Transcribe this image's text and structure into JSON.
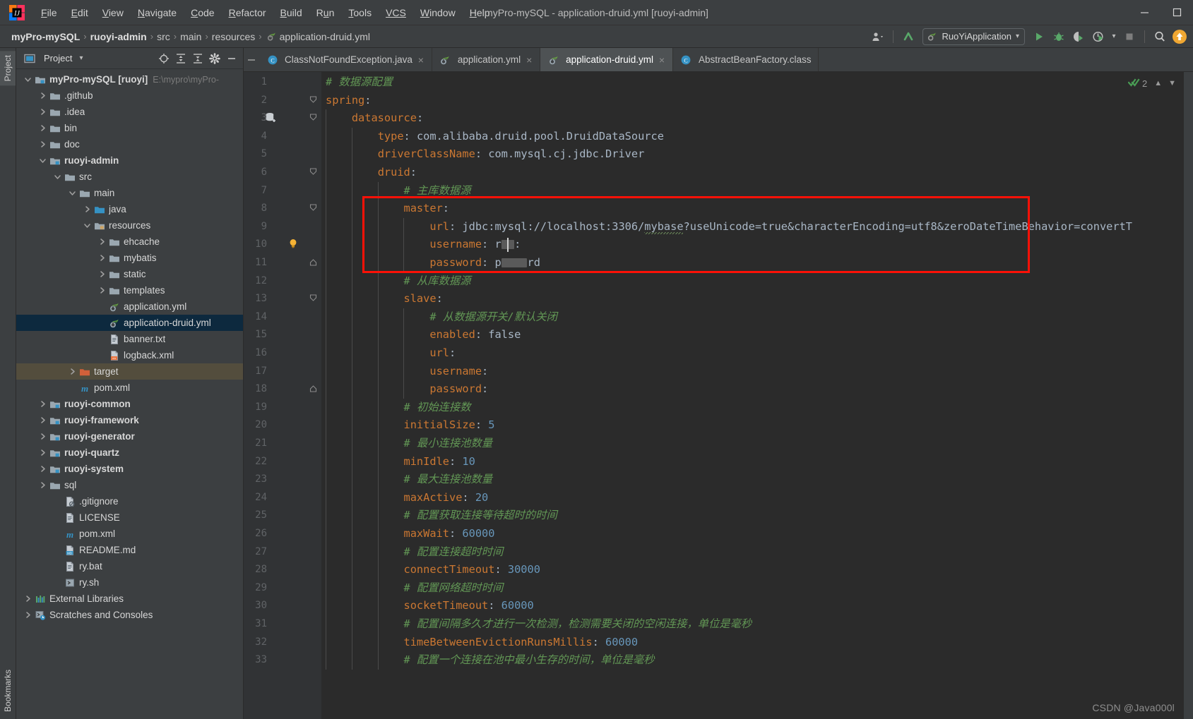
{
  "window": {
    "title": "myPro-mySQL - application-druid.yml [ruoyi-admin]",
    "minimize": "—",
    "maximize": "❐",
    "app_icon": "intellij-idea-logo"
  },
  "menubar": [
    {
      "label": "File",
      "mnemonic": "F"
    },
    {
      "label": "Edit",
      "mnemonic": "E"
    },
    {
      "label": "View",
      "mnemonic": "V"
    },
    {
      "label": "Navigate",
      "mnemonic": "N"
    },
    {
      "label": "Code",
      "mnemonic": "C"
    },
    {
      "label": "Refactor",
      "mnemonic": "R"
    },
    {
      "label": "Build",
      "mnemonic": "B"
    },
    {
      "label": "Run",
      "mnemonic": "u"
    },
    {
      "label": "Tools",
      "mnemonic": "T"
    },
    {
      "label": "VCS",
      "mnemonic": "V"
    },
    {
      "label": "Window",
      "mnemonic": "W"
    },
    {
      "label": "Help",
      "mnemonic": "H"
    }
  ],
  "breadcrumb": {
    "separator": "›",
    "items": [
      {
        "label": "myPro-mySQL",
        "bold": true,
        "icon": ""
      },
      {
        "label": "ruoyi-admin",
        "bold": true,
        "icon": ""
      },
      {
        "label": "src",
        "bold": false,
        "icon": ""
      },
      {
        "label": "main",
        "bold": false,
        "icon": ""
      },
      {
        "label": "resources",
        "bold": false,
        "icon": ""
      },
      {
        "label": "application-druid.yml",
        "bold": false,
        "icon": "spring-yaml-icon"
      }
    ]
  },
  "toolbar": {
    "run_configuration": "RuoYiApplication",
    "dropdown_caret": "▾",
    "buttons": [
      {
        "name": "user-settings-icon",
        "label": ""
      },
      {
        "name": "update-project-icon",
        "label": ""
      },
      {
        "name": "run-icon",
        "label": ""
      },
      {
        "name": "debug-icon",
        "label": ""
      },
      {
        "name": "run-with-coverage-icon",
        "label": ""
      },
      {
        "name": "profile-icon",
        "label": ""
      },
      {
        "name": "stop-icon",
        "label": ""
      },
      {
        "name": "search-everywhere-icon",
        "label": ""
      },
      {
        "name": "notifications-icon",
        "label": ""
      }
    ]
  },
  "left_strip": {
    "top_tab": "Project",
    "bottom_tab": "Bookmarks"
  },
  "project_panel": {
    "title": "Project",
    "title_caret": "▾",
    "header_icons": [
      "locate-icon",
      "expand-all-icon",
      "collapse-all-icon",
      "settings-gear-icon",
      "hide-icon"
    ],
    "tree": [
      {
        "depth": 0,
        "label": "myPro-mySQL [ruoyi]",
        "hint": "E:\\mypro\\myPro-",
        "icon": "module-folder-icon",
        "arrow": "expanded",
        "bold": true
      },
      {
        "depth": 1,
        "label": ".github",
        "icon": "folder-icon",
        "arrow": "collapsed"
      },
      {
        "depth": 1,
        "label": ".idea",
        "icon": "folder-icon",
        "arrow": "collapsed"
      },
      {
        "depth": 1,
        "label": "bin",
        "icon": "folder-icon",
        "arrow": "collapsed"
      },
      {
        "depth": 1,
        "label": "doc",
        "icon": "folder-icon",
        "arrow": "collapsed"
      },
      {
        "depth": 1,
        "label": "ruoyi-admin",
        "icon": "module-folder-icon",
        "arrow": "expanded",
        "bold": true
      },
      {
        "depth": 2,
        "label": "src",
        "icon": "folder-icon",
        "arrow": "expanded"
      },
      {
        "depth": 3,
        "label": "main",
        "icon": "folder-icon",
        "arrow": "expanded"
      },
      {
        "depth": 4,
        "label": "java",
        "icon": "source-folder-icon",
        "arrow": "collapsed"
      },
      {
        "depth": 4,
        "label": "resources",
        "icon": "resource-folder-icon",
        "arrow": "expanded"
      },
      {
        "depth": 5,
        "label": "ehcache",
        "icon": "folder-icon",
        "arrow": "collapsed"
      },
      {
        "depth": 5,
        "label": "mybatis",
        "icon": "folder-icon",
        "arrow": "collapsed"
      },
      {
        "depth": 5,
        "label": "static",
        "icon": "folder-icon",
        "arrow": "collapsed"
      },
      {
        "depth": 5,
        "label": "templates",
        "icon": "folder-icon",
        "arrow": "collapsed"
      },
      {
        "depth": 5,
        "label": "application.yml",
        "icon": "spring-yaml-icon",
        "arrow": "none"
      },
      {
        "depth": 5,
        "label": "application-druid.yml",
        "icon": "spring-yaml-icon",
        "arrow": "none",
        "selected": true
      },
      {
        "depth": 5,
        "label": "banner.txt",
        "icon": "text-file-icon",
        "arrow": "none"
      },
      {
        "depth": 5,
        "label": "logback.xml",
        "icon": "xml-file-icon",
        "arrow": "none"
      },
      {
        "depth": 3,
        "label": "target",
        "icon": "target-folder-icon",
        "arrow": "collapsed",
        "highlight": true
      },
      {
        "depth": 3,
        "label": "pom.xml",
        "icon": "maven-icon",
        "arrow": "none"
      },
      {
        "depth": 1,
        "label": "ruoyi-common",
        "icon": "module-folder-icon",
        "arrow": "collapsed",
        "bold": true
      },
      {
        "depth": 1,
        "label": "ruoyi-framework",
        "icon": "module-folder-icon",
        "arrow": "collapsed",
        "bold": true
      },
      {
        "depth": 1,
        "label": "ruoyi-generator",
        "icon": "module-folder-icon",
        "arrow": "collapsed",
        "bold": true
      },
      {
        "depth": 1,
        "label": "ruoyi-quartz",
        "icon": "module-folder-icon",
        "arrow": "collapsed",
        "bold": true
      },
      {
        "depth": 1,
        "label": "ruoyi-system",
        "icon": "module-folder-icon",
        "arrow": "collapsed",
        "bold": true
      },
      {
        "depth": 1,
        "label": "sql",
        "icon": "folder-icon",
        "arrow": "collapsed"
      },
      {
        "depth": 2,
        "label": ".gitignore",
        "icon": "gitignore-icon",
        "arrow": "none"
      },
      {
        "depth": 2,
        "label": "LICENSE",
        "icon": "text-file-icon",
        "arrow": "none"
      },
      {
        "depth": 2,
        "label": "pom.xml",
        "icon": "maven-icon",
        "arrow": "none"
      },
      {
        "depth": 2,
        "label": "README.md",
        "icon": "markdown-icon",
        "arrow": "none"
      },
      {
        "depth": 2,
        "label": "ry.bat",
        "icon": "text-file-icon",
        "arrow": "none"
      },
      {
        "depth": 2,
        "label": "ry.sh",
        "icon": "shell-script-icon",
        "arrow": "none"
      },
      {
        "depth": 0,
        "label": "External Libraries",
        "icon": "libraries-icon",
        "arrow": "collapsed"
      },
      {
        "depth": 0,
        "label": "Scratches and Consoles",
        "icon": "scratches-icon",
        "arrow": "collapsed"
      }
    ]
  },
  "editor_tabs": [
    {
      "label": "ClassNotFoundException.java",
      "icon": "java-class-icon",
      "active": false,
      "close": "×"
    },
    {
      "label": "application.yml",
      "icon": "spring-yaml-icon",
      "active": false,
      "close": "×"
    },
    {
      "label": "application-druid.yml",
      "icon": "spring-yaml-icon",
      "active": true,
      "close": "×"
    },
    {
      "label": "AbstractBeanFactory.class",
      "icon": "java-class-icon",
      "active": false,
      "close": "×"
    }
  ],
  "inspection": {
    "icon": "inspection-ok-icon",
    "count": "2",
    "up_caret": "⌃",
    "down_caret": "⌄"
  },
  "watermark": "CSDN @Java000l",
  "code": {
    "language": "yaml",
    "file": "application-druid.yml",
    "line_count": 33,
    "lines": [
      {
        "n": 1,
        "indent": 0,
        "tokens": [
          {
            "t": "comment",
            "v": "# 数据源配置"
          }
        ]
      },
      {
        "n": 2,
        "indent": 0,
        "tokens": [
          {
            "t": "key",
            "v": "spring"
          },
          {
            "t": "plain",
            "v": ":"
          }
        ],
        "fold": "start"
      },
      {
        "n": 3,
        "indent": 1,
        "tokens": [
          {
            "t": "key",
            "v": "datasource"
          },
          {
            "t": "plain",
            "v": ":"
          }
        ],
        "fold": "start",
        "gutter_icon": "datasource-icon"
      },
      {
        "n": 4,
        "indent": 2,
        "tokens": [
          {
            "t": "key",
            "v": "type"
          },
          {
            "t": "plain",
            "v": ": "
          },
          {
            "t": "str",
            "v": "com.alibaba.druid.pool.DruidDataSource"
          }
        ]
      },
      {
        "n": 5,
        "indent": 2,
        "tokens": [
          {
            "t": "key",
            "v": "driverClassName"
          },
          {
            "t": "plain",
            "v": ": "
          },
          {
            "t": "str",
            "v": "com.mysql.cj.jdbc.Driver"
          }
        ]
      },
      {
        "n": 6,
        "indent": 2,
        "tokens": [
          {
            "t": "key",
            "v": "druid"
          },
          {
            "t": "plain",
            "v": ":"
          }
        ],
        "fold": "start"
      },
      {
        "n": 7,
        "indent": 3,
        "tokens": [
          {
            "t": "comment",
            "v": "# 主库数据源"
          }
        ]
      },
      {
        "n": 8,
        "indent": 3,
        "tokens": [
          {
            "t": "key",
            "v": "master"
          },
          {
            "t": "plain",
            "v": ":"
          }
        ],
        "fold": "start"
      },
      {
        "n": 9,
        "indent": 4,
        "tokens": [
          {
            "t": "key",
            "v": "url"
          },
          {
            "t": "plain",
            "v": ": "
          },
          {
            "t": "str",
            "v": "jdbc:mysql://localhost:3306/mybase?useUnicode=true&characterEncoding=utf8&zeroDateTimeBehavior=convertT"
          }
        ]
      },
      {
        "n": 10,
        "indent": 4,
        "tokens": [
          {
            "t": "key",
            "v": "username"
          },
          {
            "t": "plain",
            "v": ": "
          },
          {
            "t": "str",
            "v": "r"
          },
          {
            "t": "censor",
            "v": "xx"
          },
          {
            "t": "str",
            "v": ":"
          }
        ],
        "gutter_icon": "intention-bulb-icon"
      },
      {
        "n": 11,
        "indent": 4,
        "tokens": [
          {
            "t": "key",
            "v": "password"
          },
          {
            "t": "plain",
            "v": ": "
          },
          {
            "t": "str",
            "v": "p"
          },
          {
            "t": "censor",
            "v": "xxxx"
          },
          {
            "t": "str",
            "v": "rd"
          }
        ],
        "fold": "end"
      },
      {
        "n": 12,
        "indent": 3,
        "tokens": [
          {
            "t": "comment",
            "v": "# 从库数据源"
          }
        ]
      },
      {
        "n": 13,
        "indent": 3,
        "tokens": [
          {
            "t": "key",
            "v": "slave"
          },
          {
            "t": "plain",
            "v": ":"
          }
        ],
        "fold": "start"
      },
      {
        "n": 14,
        "indent": 4,
        "tokens": [
          {
            "t": "comment",
            "v": "# 从数据源开关/默认关闭"
          }
        ]
      },
      {
        "n": 15,
        "indent": 4,
        "tokens": [
          {
            "t": "key",
            "v": "enabled"
          },
          {
            "t": "plain",
            "v": ": "
          },
          {
            "t": "str",
            "v": "false"
          }
        ]
      },
      {
        "n": 16,
        "indent": 4,
        "tokens": [
          {
            "t": "key",
            "v": "url"
          },
          {
            "t": "plain",
            "v": ":"
          }
        ]
      },
      {
        "n": 17,
        "indent": 4,
        "tokens": [
          {
            "t": "key",
            "v": "username"
          },
          {
            "t": "plain",
            "v": ":"
          }
        ]
      },
      {
        "n": 18,
        "indent": 4,
        "tokens": [
          {
            "t": "key",
            "v": "password"
          },
          {
            "t": "plain",
            "v": ":"
          }
        ],
        "fold": "end"
      },
      {
        "n": 19,
        "indent": 3,
        "tokens": [
          {
            "t": "comment",
            "v": "# 初始连接数"
          }
        ]
      },
      {
        "n": 20,
        "indent": 3,
        "tokens": [
          {
            "t": "key",
            "v": "initialSize"
          },
          {
            "t": "plain",
            "v": ": "
          },
          {
            "t": "num",
            "v": "5"
          }
        ]
      },
      {
        "n": 21,
        "indent": 3,
        "tokens": [
          {
            "t": "comment",
            "v": "# 最小连接池数量"
          }
        ]
      },
      {
        "n": 22,
        "indent": 3,
        "tokens": [
          {
            "t": "key",
            "v": "minIdle"
          },
          {
            "t": "plain",
            "v": ": "
          },
          {
            "t": "num",
            "v": "10"
          }
        ]
      },
      {
        "n": 23,
        "indent": 3,
        "tokens": [
          {
            "t": "comment",
            "v": "# 最大连接池数量"
          }
        ]
      },
      {
        "n": 24,
        "indent": 3,
        "tokens": [
          {
            "t": "key",
            "v": "maxActive"
          },
          {
            "t": "plain",
            "v": ": "
          },
          {
            "t": "num",
            "v": "20"
          }
        ]
      },
      {
        "n": 25,
        "indent": 3,
        "tokens": [
          {
            "t": "comment",
            "v": "# 配置获取连接等待超时的时间"
          }
        ]
      },
      {
        "n": 26,
        "indent": 3,
        "tokens": [
          {
            "t": "key",
            "v": "maxWait"
          },
          {
            "t": "plain",
            "v": ": "
          },
          {
            "t": "num",
            "v": "60000"
          }
        ]
      },
      {
        "n": 27,
        "indent": 3,
        "tokens": [
          {
            "t": "comment",
            "v": "# 配置连接超时时间"
          }
        ]
      },
      {
        "n": 28,
        "indent": 3,
        "tokens": [
          {
            "t": "key",
            "v": "connectTimeout"
          },
          {
            "t": "plain",
            "v": ": "
          },
          {
            "t": "num",
            "v": "30000"
          }
        ]
      },
      {
        "n": 29,
        "indent": 3,
        "tokens": [
          {
            "t": "comment",
            "v": "# 配置网络超时时间"
          }
        ]
      },
      {
        "n": 30,
        "indent": 3,
        "tokens": [
          {
            "t": "key",
            "v": "socketTimeout"
          },
          {
            "t": "plain",
            "v": ": "
          },
          {
            "t": "num",
            "v": "60000"
          }
        ]
      },
      {
        "n": 31,
        "indent": 3,
        "tokens": [
          {
            "t": "comment",
            "v": "# 配置间隔多久才进行一次检测，检测需要关闭的空闲连接，单位是毫秒"
          }
        ]
      },
      {
        "n": 32,
        "indent": 3,
        "tokens": [
          {
            "t": "key",
            "v": "timeBetweenEvictionRunsMillis"
          },
          {
            "t": "plain",
            "v": ": "
          },
          {
            "t": "num",
            "v": "60000"
          }
        ]
      },
      {
        "n": 33,
        "indent": 3,
        "tokens": [
          {
            "t": "comment",
            "v": "# 配置一个连接在池中最小生存的时间，单位是毫秒"
          }
        ]
      }
    ],
    "annotation_box": {
      "color": "#fc1107",
      "covers_lines": [
        8,
        11
      ],
      "label": "red-highlight-rectangle"
    }
  },
  "colors": {
    "ide_chrome": "#3c3f41",
    "editor_bg": "#2b2b2b",
    "gutter_bg": "#313335",
    "selection": "#0d293e",
    "target_folder": "#534d3d",
    "accent_red": "#fc1107",
    "comment_green": "#629755",
    "key_orange": "#cc7832",
    "number_blue": "#6897bb",
    "text_grey": "#a9b7c6"
  }
}
